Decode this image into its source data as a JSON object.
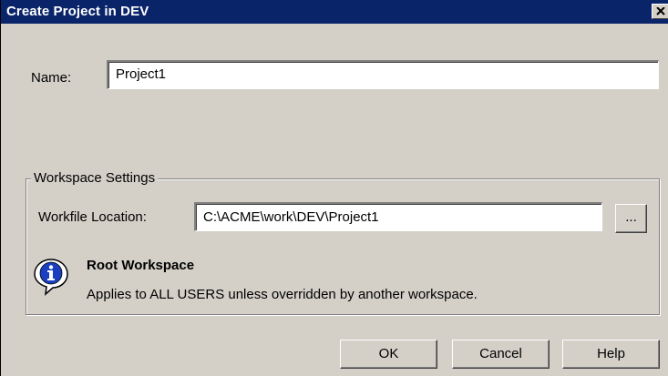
{
  "window": {
    "title": "Create Project in DEV",
    "close_glyph": "close-icon"
  },
  "name_field": {
    "label": "Name:",
    "value": "Project1"
  },
  "workspace": {
    "group_title": "Workspace Settings",
    "location_label": "Workfile Location:",
    "location_value": "C:\\ACME\\work\\DEV\\Project1",
    "browse_label": "...",
    "info_icon": "info-icon",
    "info_title": "Root Workspace",
    "info_text": "Applies to ALL USERS unless overridden by another workspace."
  },
  "buttons": {
    "ok": "OK",
    "cancel": "Cancel",
    "help": "Help"
  },
  "colors": {
    "titlebar": "#0a246a",
    "dialog_bg": "#d4d0c8"
  }
}
